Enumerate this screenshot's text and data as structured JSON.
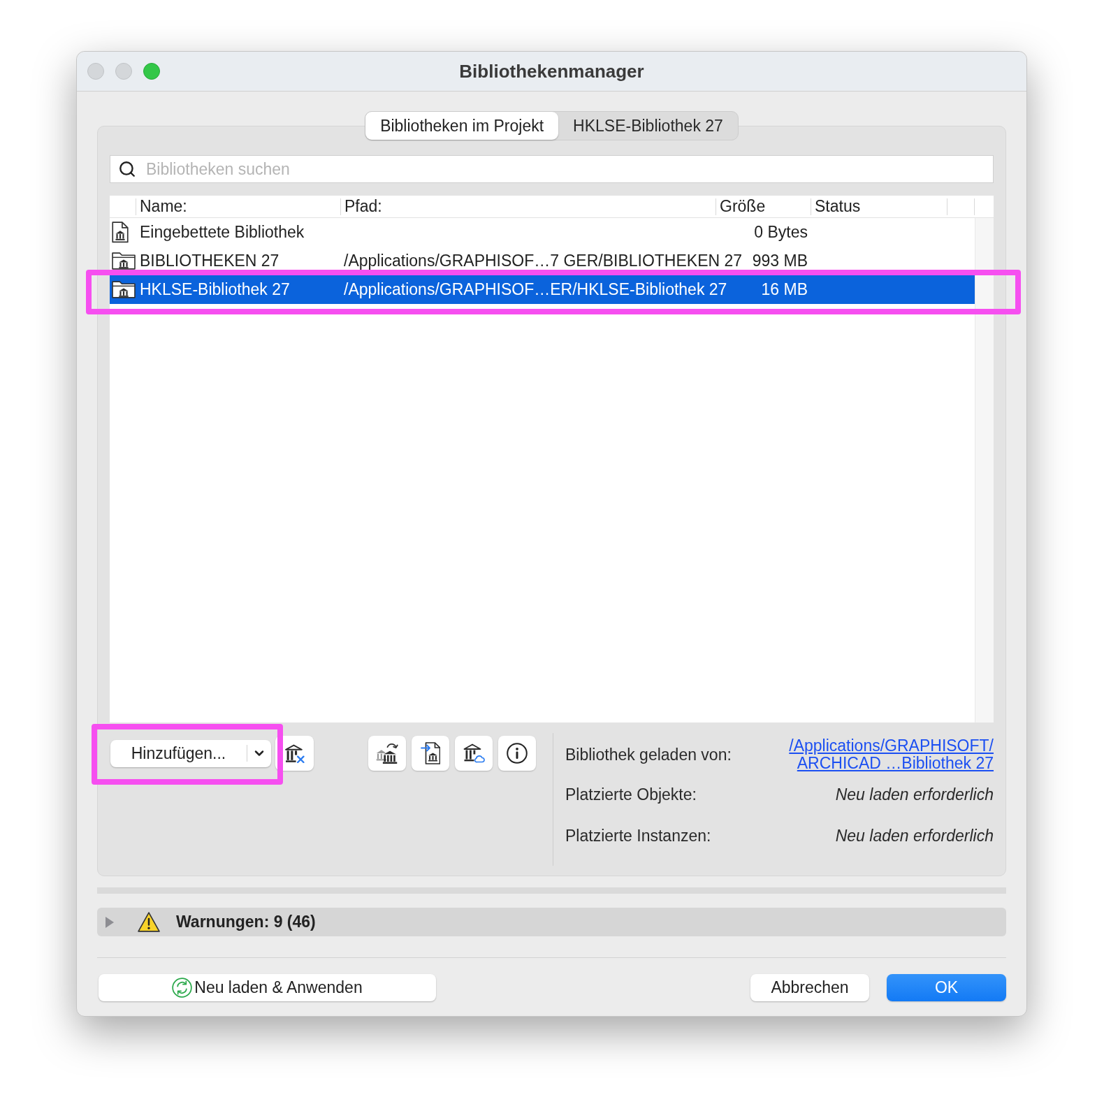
{
  "window": {
    "title": "Bibliothekenmanager",
    "controls": [
      {
        "kind": "close",
        "enabled": false
      },
      {
        "kind": "minimize",
        "enabled": false
      },
      {
        "kind": "zoom",
        "enabled": true
      }
    ]
  },
  "tabs": [
    {
      "label": "Bibliotheken im Projekt",
      "selected": true
    },
    {
      "label": "HKLSE-Bibliothek 27",
      "selected": false
    }
  ],
  "search": {
    "placeholder": "Bibliotheken suchen"
  },
  "table": {
    "columns": [
      "Name:",
      "Pfad:",
      "Größe",
      "Status"
    ],
    "rows": [
      {
        "kind": "embedded",
        "name": "Eingebettete Bibliothek",
        "size": "0 Bytes",
        "selected": false,
        "highlighted": false
      },
      {
        "kind": "folder",
        "name": "BIBLIOTHEKEN 27",
        "path": "/Applications/GRAPHISOF…7 GER/BIBLIOTHEKEN 27",
        "size": "993 MB",
        "selected": false,
        "highlighted": false
      },
      {
        "kind": "folder",
        "name": "HKLSE-Bibliothek 27",
        "path": "/Applications/GRAPHISOF…ER/HKLSE-Bibliothek 27",
        "size": "16 MB",
        "selected": true,
        "highlighted": true
      }
    ]
  },
  "add_button": {
    "label": "Hinzufügen...",
    "highlighted": true
  },
  "info": [
    {
      "label": "Bibliothek geladen von:",
      "kind": "link",
      "lines": [
        "/Applications/GRAPHISOFT/",
        "ARCHICAD …Bibliothek 27"
      ]
    },
    {
      "label": "Platzierte Objekte:",
      "kind": "note",
      "lines": [
        "Neu laden erforderlich"
      ]
    },
    {
      "label": "Platzierte Instanzen:",
      "kind": "note",
      "lines": [
        "Neu laden erforderlich"
      ]
    }
  ],
  "warnings": {
    "label": "Warnungen: 9 (46)",
    "expanded": false
  },
  "buttons": [
    {
      "kind": "reload",
      "label": "Neu laden & Anwenden"
    },
    {
      "kind": "cancel",
      "label": "Abbrechen"
    },
    {
      "kind": "default",
      "label": "OK"
    }
  ]
}
